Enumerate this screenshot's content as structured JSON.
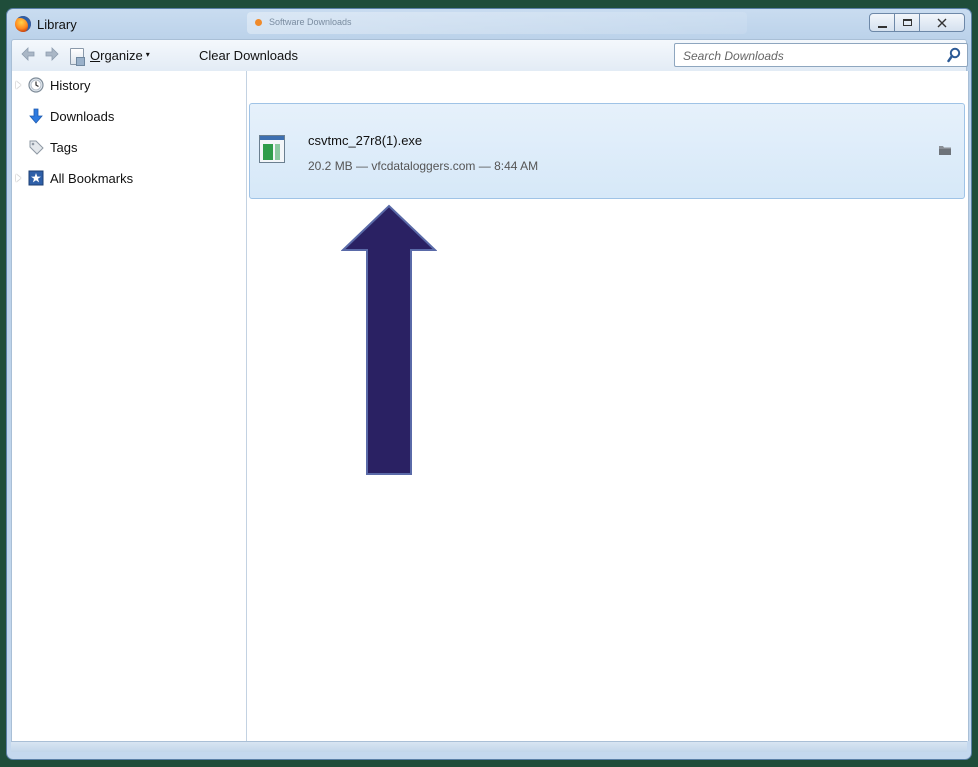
{
  "window": {
    "title": "Library",
    "background_tab_text": "Software Downloads",
    "controls": {
      "minimize": "",
      "maximize": "",
      "close": ""
    }
  },
  "toolbar": {
    "organize_prefix": "O",
    "organize_rest": "rganize",
    "organize_caret": "▾",
    "clear_downloads": "Clear Downloads",
    "search_placeholder": "Search Downloads"
  },
  "sidebar": {
    "items": [
      {
        "label": "History",
        "icon": "clock-icon",
        "expandable": true
      },
      {
        "label": "Downloads",
        "icon": "download-arrow-icon",
        "expandable": false,
        "selected": true
      },
      {
        "label": "Tags",
        "icon": "tag-icon",
        "expandable": false
      },
      {
        "label": "All Bookmarks",
        "icon": "bookmark-star-icon",
        "expandable": true
      }
    ]
  },
  "downloads": [
    {
      "file_name": "csvtmc_27r8(1).exe",
      "meta": "20.2 MB — vfcdataloggers.com — 8:44 AM",
      "icon": "exe-file-icon",
      "action_icon": "open-folder-icon"
    }
  ],
  "annotation": {
    "shape": "up-arrow",
    "color": "#2a2163"
  },
  "colors": {
    "desktop": "#1f4d3a",
    "selection": "#d6e8f8",
    "arrow_fill": "#2a2163"
  }
}
